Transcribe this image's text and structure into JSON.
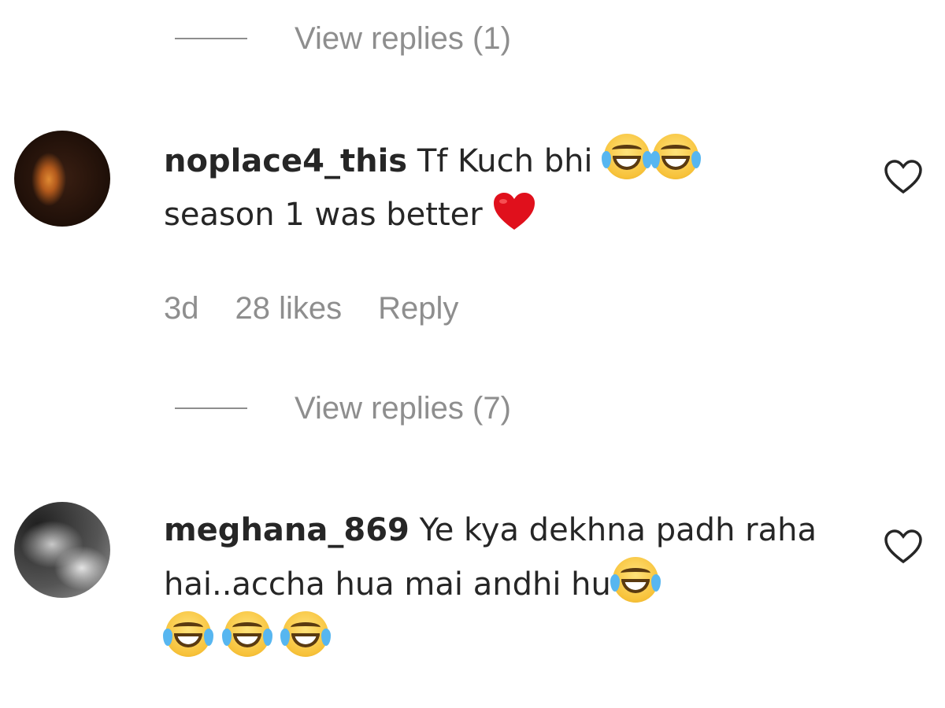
{
  "thread": {
    "view_replies_1": "View replies (1)",
    "view_replies_2": "View replies (7)"
  },
  "comments": [
    {
      "username": "noplace4_this",
      "text_part1": "Tf Kuch bhi",
      "text_part2": "season 1 was better",
      "emoji_names": [
        "laughing-tears-emoji",
        "laughing-tears-emoji",
        "red-heart-emoji"
      ],
      "meta": {
        "age": "3d",
        "likes": "28 likes",
        "reply_label": "Reply"
      }
    },
    {
      "username": "meghana_869",
      "text_part1": "Ye kya dekhna padh raha hai..accha hua mai andhi hu",
      "emoji_names": [
        "laughing-tears-emoji",
        "laughing-tears-emoji",
        "laughing-tears-emoji",
        "laughing-tears-emoji"
      ]
    }
  ],
  "icons": {
    "like": "heart-outline-icon"
  },
  "colors": {
    "text_primary": "#262626",
    "text_secondary": "#8e8e8e",
    "heart_emoji": "#e0101c",
    "emoji_face": "#f7c23a",
    "emoji_tear": "#57b6f0"
  }
}
